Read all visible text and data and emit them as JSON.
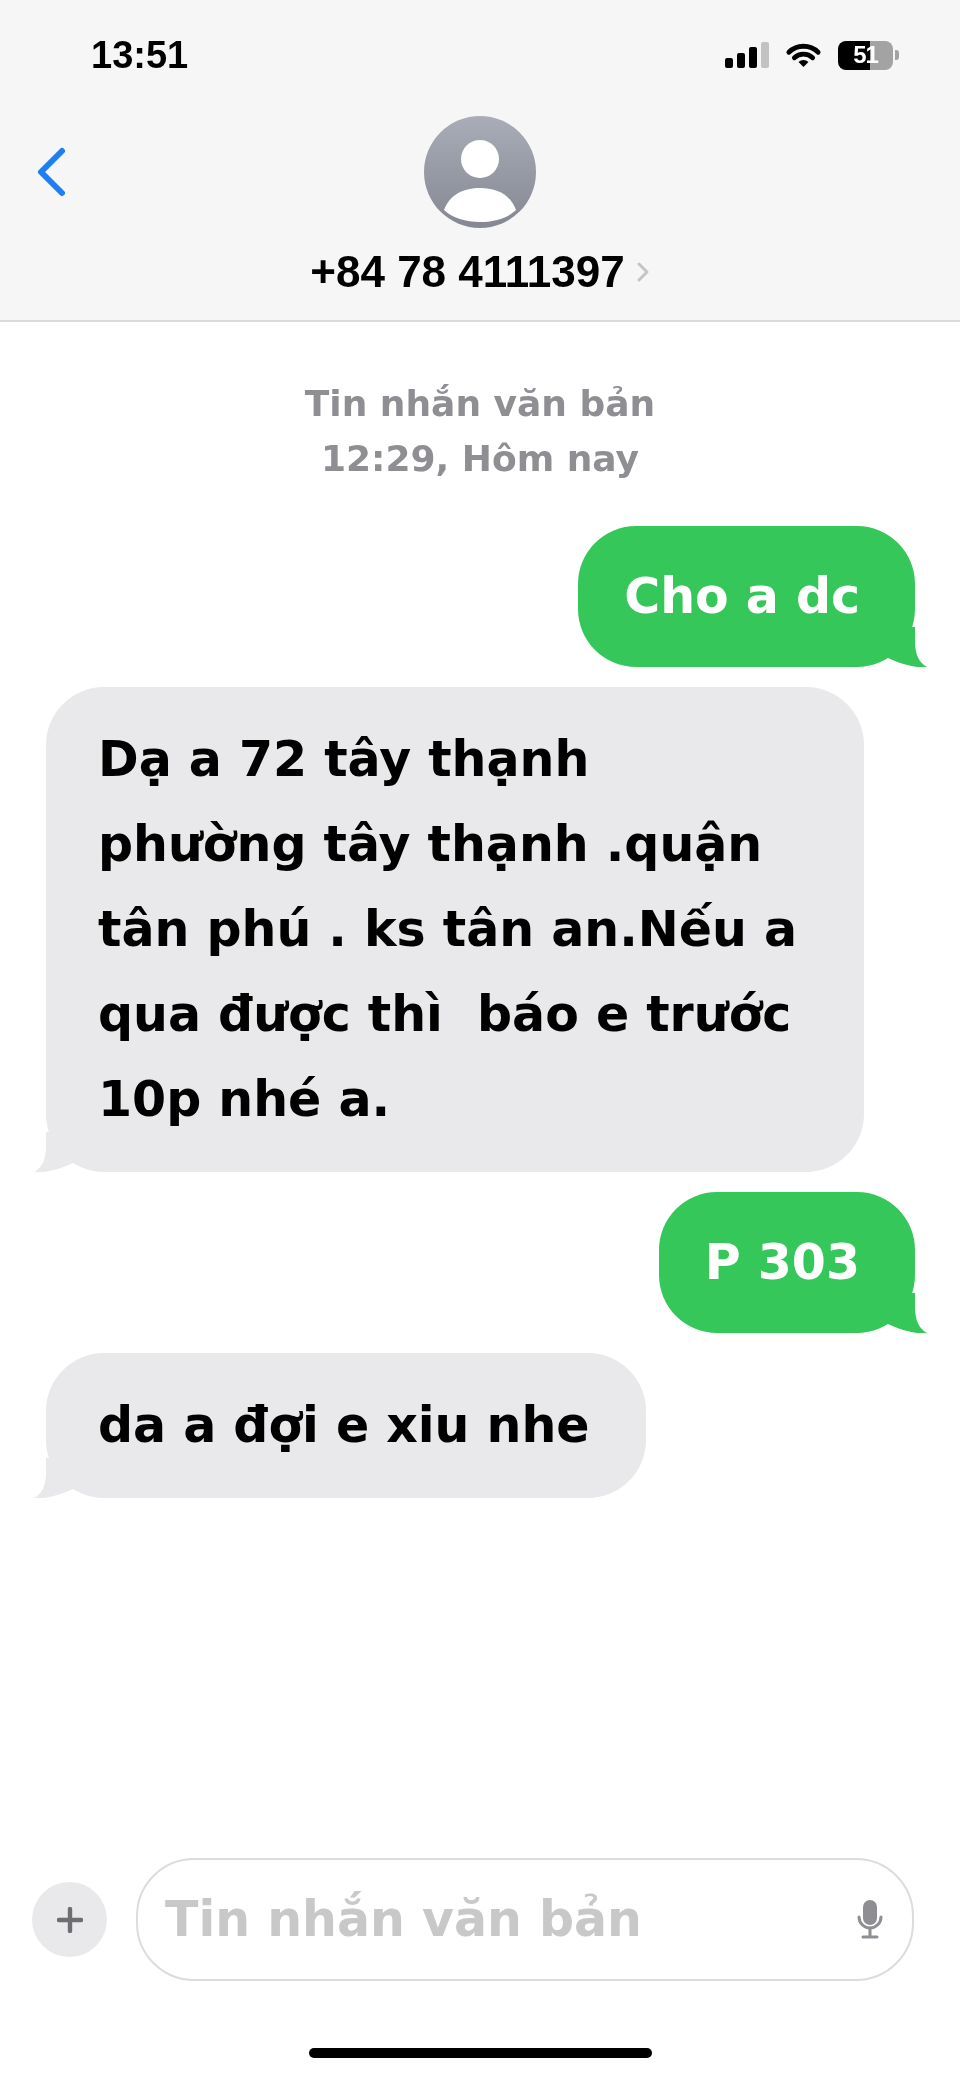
{
  "status_bar": {
    "time": "13:51",
    "battery_percent": "51"
  },
  "header": {
    "contact": "+84 78 4111397"
  },
  "conversation": {
    "service_label": "Tin nhắn văn bản",
    "date_label": "12:29, Hôm nay",
    "messages": [
      {
        "kind": "sent",
        "text": "Cho a dc"
      },
      {
        "kind": "received",
        "text": "Dạ a 72 tây thạnh phường tây thạnh .quận tân phú . ks tân an.Nếu a qua được thì  báo e trước 10p nhé a."
      },
      {
        "kind": "sent",
        "text": "P 303"
      },
      {
        "kind": "received",
        "text": "da a đợi e xiu nhe"
      }
    ]
  },
  "composer": {
    "placeholder": "Tin nhắn văn bản"
  }
}
